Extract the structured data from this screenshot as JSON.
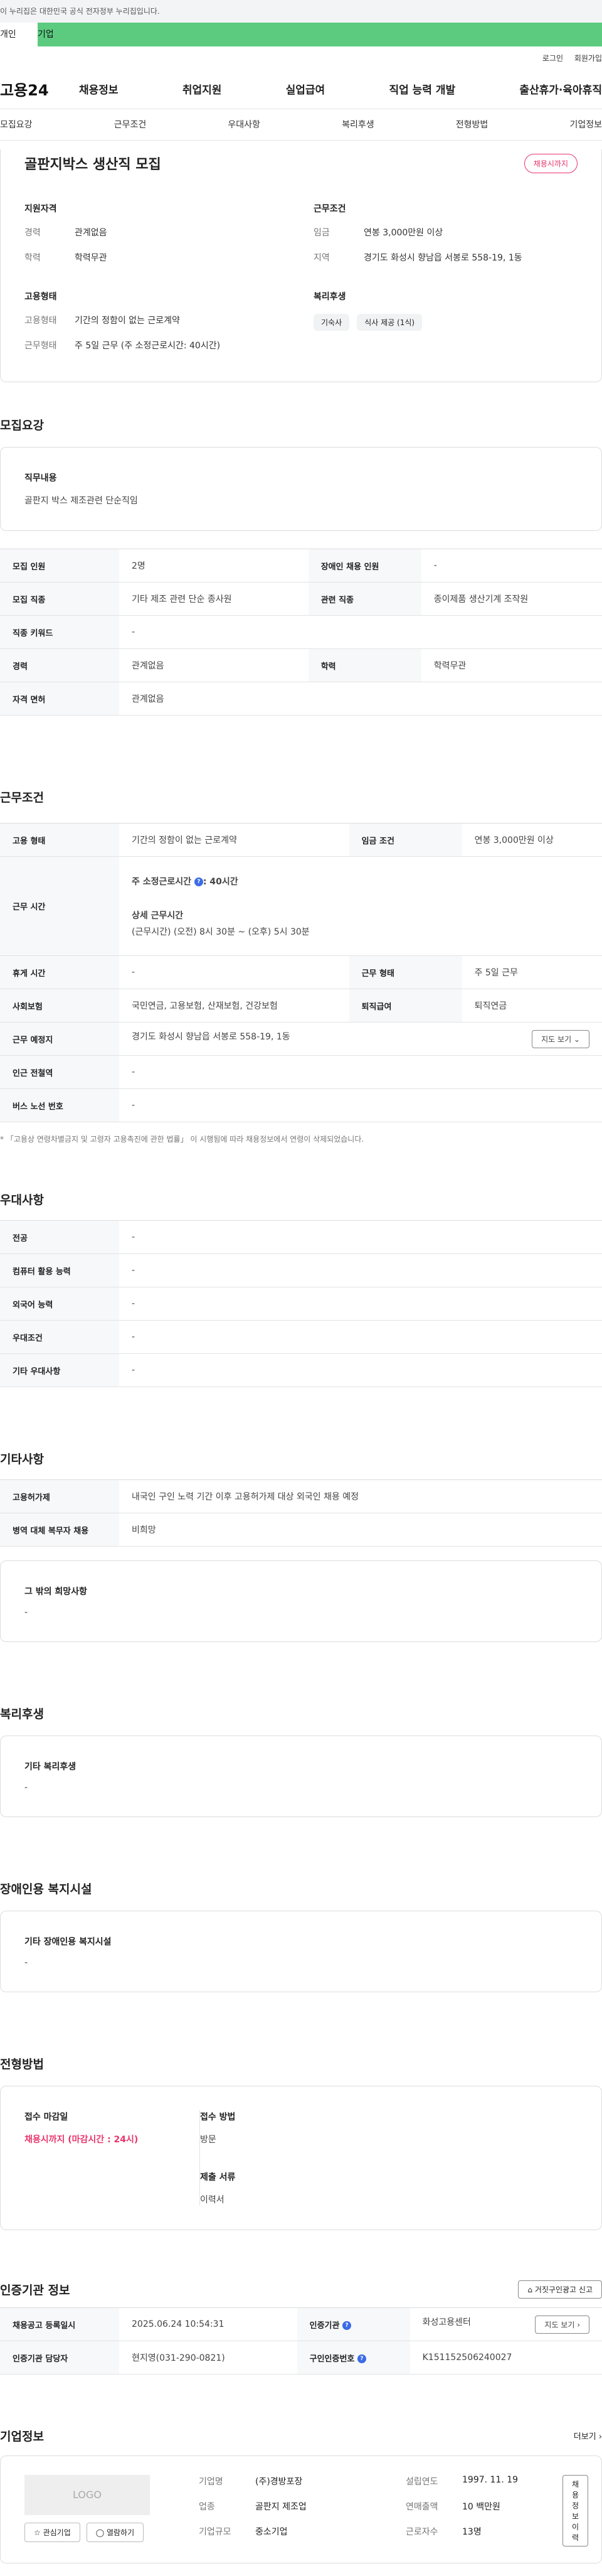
{
  "banner": "이 누리집은 대한민국 공식 전자정부 누리집입니다.",
  "usertabs": {
    "personal": "개인",
    "company": "기업"
  },
  "util": {
    "login": "로그인",
    "join": "회원가입"
  },
  "logo": "고용24",
  "gnb": [
    "채용정보",
    "취업지원",
    "실업급여",
    "직업 능력 개발",
    "출산휴가·육아휴직"
  ],
  "subnav": [
    "모집요강",
    "근무조건",
    "우대사항",
    "복리후생",
    "전형방법",
    "기업정보"
  ],
  "job": {
    "title": "골판지박스 생산직 모집",
    "badge": "채용시까지",
    "qual_title": "지원자격",
    "career_k": "경력",
    "career_v": "관계없음",
    "edu_k": "학력",
    "edu_v": "학력무관",
    "emp_title": "고용형태",
    "emp_k": "고용형태",
    "emp_v": "기간의 정함이 없는 근로계약",
    "worktype_k": "근무형태",
    "worktype_v": "주 5일 근무 (주 소정근로시간: 40시간)",
    "cond_title": "근무조건",
    "wage_k": "임금",
    "wage_v": "연봉 3,000만원 이상",
    "area_k": "지역",
    "area_v": "경기도 화성시 향남읍 서봉로 558-19, 1동",
    "welfare_title": "복리후생",
    "tags": [
      "기숙사",
      "식사 제공 (1식)"
    ]
  },
  "recruit": {
    "title": "모집요강",
    "duty_lbl": "직무내용",
    "duty_val": "골판지 박스 제조관련 단순직임",
    "rows": [
      {
        "k1": "모집 인원",
        "v1": "2명",
        "k2": "장애인 채용 인원",
        "v2": "-"
      },
      {
        "k1": "모집 직종",
        "v1": "기타 제조 관련 단순 종사원",
        "k2": "관련 직종",
        "v2": "종이제품 생산기계 조작원"
      },
      {
        "k1": "직종 키워드",
        "v1": "-"
      },
      {
        "k1": "경력",
        "v1": "관계없음",
        "k2": "학력",
        "v2": "학력무관"
      },
      {
        "k1": "자격 면허",
        "v1": "관계없음"
      }
    ]
  },
  "work": {
    "title": "근무조건",
    "emp_k": "고용 형태",
    "emp_v": "기간의 정함이 없는 근로계약",
    "wage_k": "임금 조건",
    "wage_v": "연봉 3,000만원 이상",
    "hours_k": "근무 시간",
    "hours_l1": "주 소정근로시간",
    "hours_q": "?",
    "hours_l1v": ": 40시간",
    "hours_l2": "상세 근무시간",
    "hours_l3": "(근무시간) (오전) 8시 30분 ~ (오후) 5시 30분",
    "rest_k": "휴게 시간",
    "rest_v": "-",
    "form_k": "근무 형태",
    "form_v": "주 5일 근무",
    "ins_k": "사회보험",
    "ins_v": "국민연금, 고용보험, 산재보험, 건강보험",
    "ret_k": "퇴직급여",
    "ret_v": "퇴직연금",
    "place_k": "근무 예정지",
    "place_v": "경기도 화성시 향남읍 서봉로 558-19, 1동",
    "map_btn": "지도 보기 ⌄",
    "sta_k": "인근 전철역",
    "sta_v": "-",
    "bus_k": "버스 노선 번호",
    "bus_v": "-",
    "note": "* 「고용상 연령차별금지 및 고령자 고용촉진에 관한 법률」 이 시행됨에 따라 채용정보에서 연령이 삭제되었습니다."
  },
  "pref": {
    "title": "우대사항",
    "rows": [
      {
        "k": "전공",
        "v": "-"
      },
      {
        "k": "컴퓨터 활용 능력",
        "v": "-"
      },
      {
        "k": "외국어 능력",
        "v": "-"
      },
      {
        "k": "우대조건",
        "v": "-"
      },
      {
        "k": "기타 우대사항",
        "v": "-"
      }
    ]
  },
  "etc": {
    "title": "기타사항",
    "rows": [
      {
        "k": "고용허가제",
        "v": "내국인 구인 노력 기간 이후 고용허가제 대상 외국인 채용 예정"
      },
      {
        "k": "병역 대체 복무자 채용",
        "v": "비희망"
      }
    ],
    "other_lbl": "그 밖의 희망사항",
    "other_val": "-"
  },
  "welfare": {
    "title": "복리후생",
    "lbl": "기타 복리후생",
    "val": "-"
  },
  "disabled": {
    "title": "장애인용 복지시설",
    "lbl": "기타 장애인용 복지시설",
    "val": "-"
  },
  "apply": {
    "title": "전형방법",
    "deadline_lbl": "접수 마감일",
    "deadline_val": "채용시까지 (마감시간 : 24시)",
    "method_lbl": "접수 방법",
    "method_val": "방문",
    "docs_lbl": "제출 서류",
    "docs_val": "이력서"
  },
  "cert": {
    "title": "인증기관 정보",
    "report_btn": "⌂ 거짓구인광고 신고",
    "date_k": "채용공고 등록일시",
    "date_v": "2025.06.24 10:54:31",
    "org_k": "인증기관",
    "org_v": "화성고용센터",
    "map_btn": "지도 보기 ›",
    "mgr_k": "인증기관 담당자",
    "mgr_v": "현지영(031-290-0821)",
    "no_k": "구인인증번호",
    "no_v": "K151152506240027",
    "q": "?"
  },
  "comp": {
    "title": "기업정보",
    "more": "더보기 ›",
    "logo": "LOGO",
    "fav_btn": "☆ 관심기업",
    "view_btn": "◯ 열람하기",
    "name_k": "기업명",
    "name_v": "(주)경방포장",
    "found_k": "설립연도",
    "found_v": "1997. 11. 19",
    "ind_k": "업종",
    "ind_v": "골판지 제조업",
    "sales_k": "연매출액",
    "sales_v": "10 백만원",
    "size_k": "기업규모",
    "size_v": "중소기업",
    "emp_k": "근로자수",
    "emp_v": "13명",
    "hist_btn": "채용정보 이력"
  }
}
